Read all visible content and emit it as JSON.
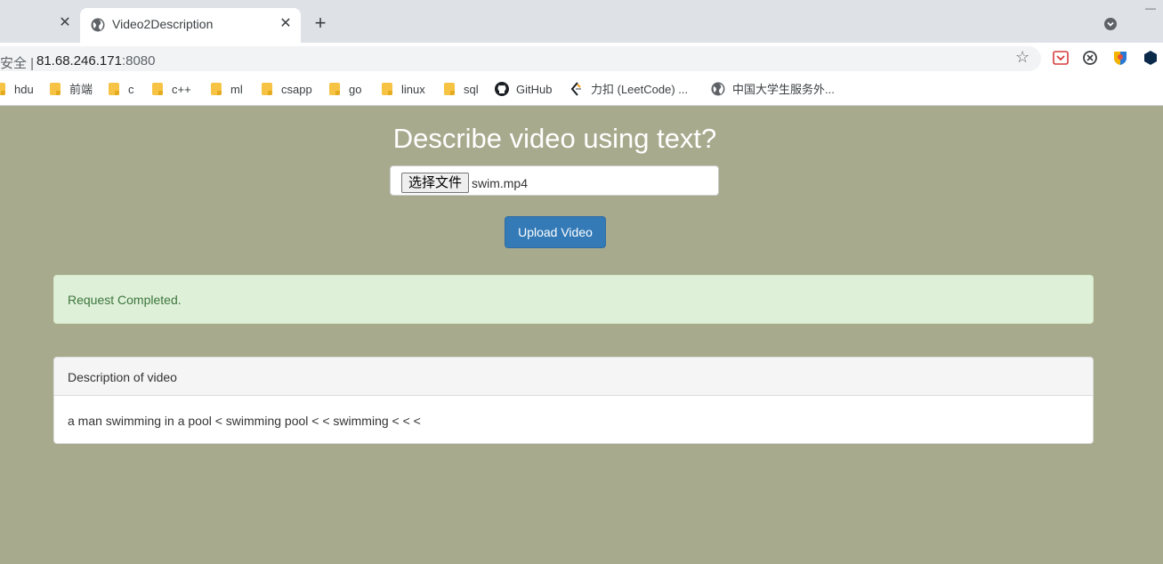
{
  "browser": {
    "tab": {
      "title": "Video2Description"
    },
    "address": {
      "security": "安全 |",
      "host": "81.68.246.171",
      "port": ":8080"
    },
    "bookmarks": [
      "hdu",
      "前端",
      "c",
      "c++",
      "ml",
      "csapp",
      "go",
      "linux",
      "sql",
      "GitHub",
      "力扣 (LeetCode) ...",
      "中国大学生服务外..."
    ]
  },
  "page": {
    "heading": "Describe video using text?",
    "file_input": {
      "button_label": "选择文件",
      "file_name": "swim.mp4"
    },
    "upload_button": "Upload Video",
    "alert": "Request Completed.",
    "panel": {
      "title": "Description of video",
      "body": "a man swimming in a pool < swimming pool < < swimming < < <"
    }
  },
  "colors": {
    "page_background": "#a7aa8d",
    "primary_button": "#337ab7",
    "alert_background": "#dff0d8",
    "alert_text": "#3c763d"
  }
}
